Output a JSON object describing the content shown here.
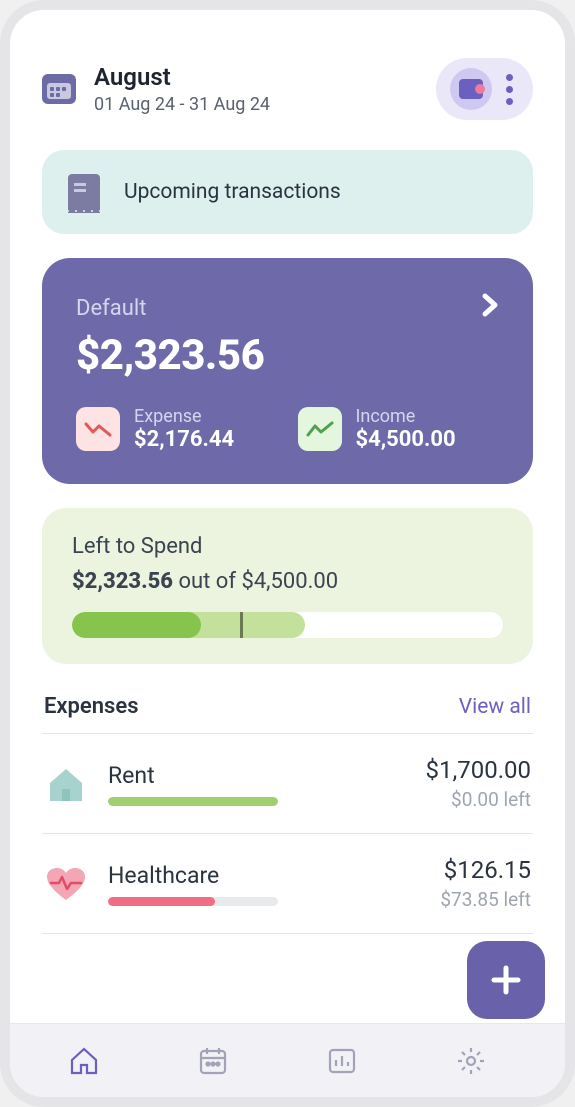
{
  "header": {
    "month": "August",
    "range": "01 Aug 24 - 31 Aug 24"
  },
  "upcoming": {
    "label": "Upcoming transactions"
  },
  "balance": {
    "account_label": "Default",
    "amount": "$2,323.56",
    "expense_label": "Expense",
    "expense_value": "$2,176.44",
    "income_label": "Income",
    "income_value": "$4,500.00"
  },
  "left_to_spend": {
    "title": "Left to Spend",
    "remaining": "$2,323.56",
    "middle_text": " out of ",
    "total": "$4,500.00"
  },
  "expenses_section": {
    "title": "Expenses",
    "view_all": "View all",
    "items": [
      {
        "name": "Rent",
        "amount": "$1,700.00",
        "left": "$0.00 left",
        "bar_pct": 100,
        "bar_color": "#9fcf6e",
        "icon": "home"
      },
      {
        "name": "Healthcare",
        "amount": "$126.15",
        "left": "$73.85 left",
        "bar_pct": 63,
        "bar_color": "#ef6d85",
        "icon": "heart"
      }
    ]
  }
}
